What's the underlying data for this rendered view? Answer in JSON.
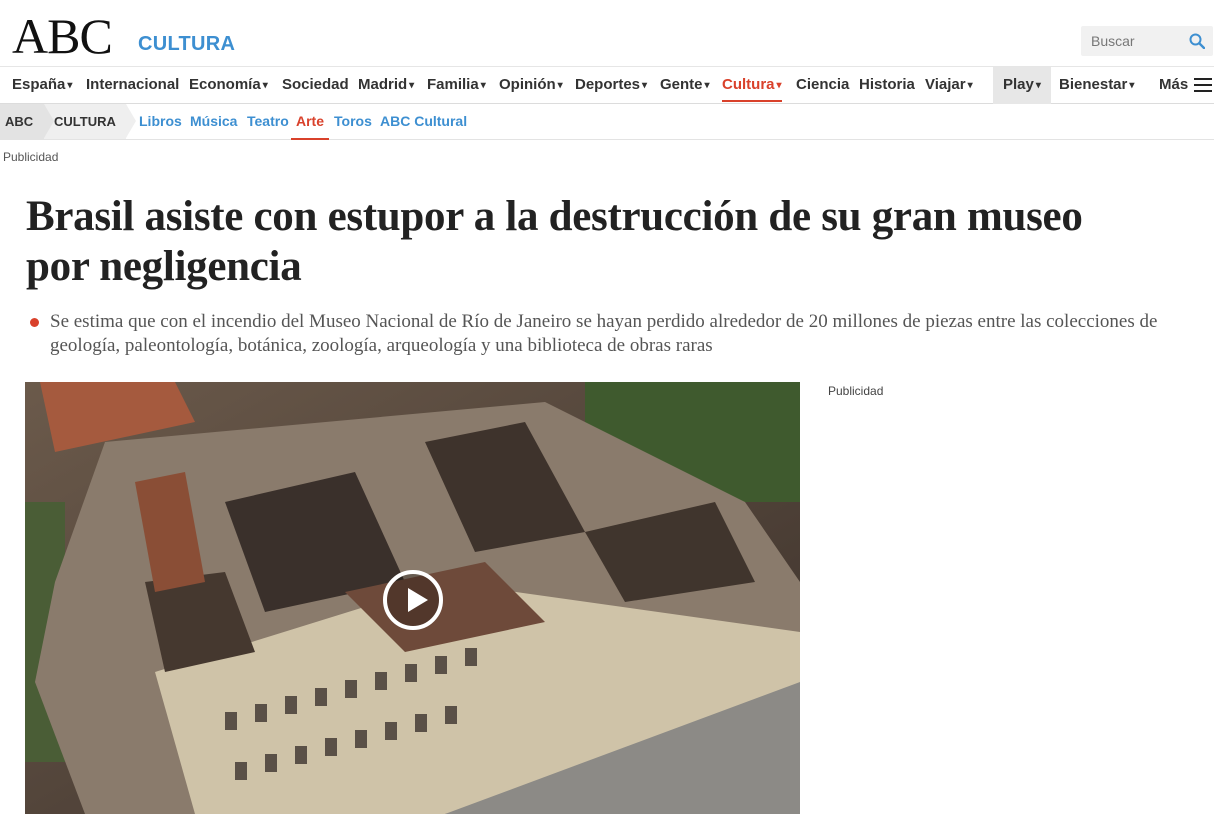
{
  "header": {
    "logo": "ABC",
    "section": "CULTURA",
    "search_placeholder": "Buscar"
  },
  "mainnav": {
    "items": [
      {
        "label": "España",
        "caret": true
      },
      {
        "label": "Internacional",
        "caret": false
      },
      {
        "label": "Economía",
        "caret": true
      },
      {
        "label": "Sociedad",
        "caret": false
      },
      {
        "label": "Madrid",
        "caret": true
      },
      {
        "label": "Familia",
        "caret": true
      },
      {
        "label": "Opinión",
        "caret": true
      },
      {
        "label": "Deportes",
        "caret": true
      },
      {
        "label": "Gente",
        "caret": true
      },
      {
        "label": "Cultura",
        "caret": true,
        "active": true
      },
      {
        "label": "Ciencia",
        "caret": false
      },
      {
        "label": "Historia",
        "caret": false
      },
      {
        "label": "Viajar",
        "caret": true
      },
      {
        "label": "Play",
        "caret": true
      },
      {
        "label": "Bienestar",
        "caret": true
      },
      {
        "label": "Más",
        "caret": false
      }
    ],
    "caret_glyph": "▾",
    "active_color": "#d9412b"
  },
  "subnav": {
    "crumbs": [
      "ABC",
      "CULTURA"
    ],
    "items": [
      "Libros",
      "Música",
      "Teatro",
      "Arte",
      "Toros",
      "ABC Cultural"
    ],
    "active": "Arte",
    "link_color": "#3d8fd1"
  },
  "ad_label_top": "Publicidad",
  "article": {
    "headline": "Brasil asiste con estupor a la destrucción de su gran museo por negligencia",
    "summary": "Se estima que con el incendio del Museo Nacional de Río de Janeiro se hayan perdido alrededor de 20 millones de piezas entre las colecciones de geología, paleontología, botánica, zoología, arqueología y una biblioteca de obras raras"
  },
  "ad_label_side": "Publicidad"
}
